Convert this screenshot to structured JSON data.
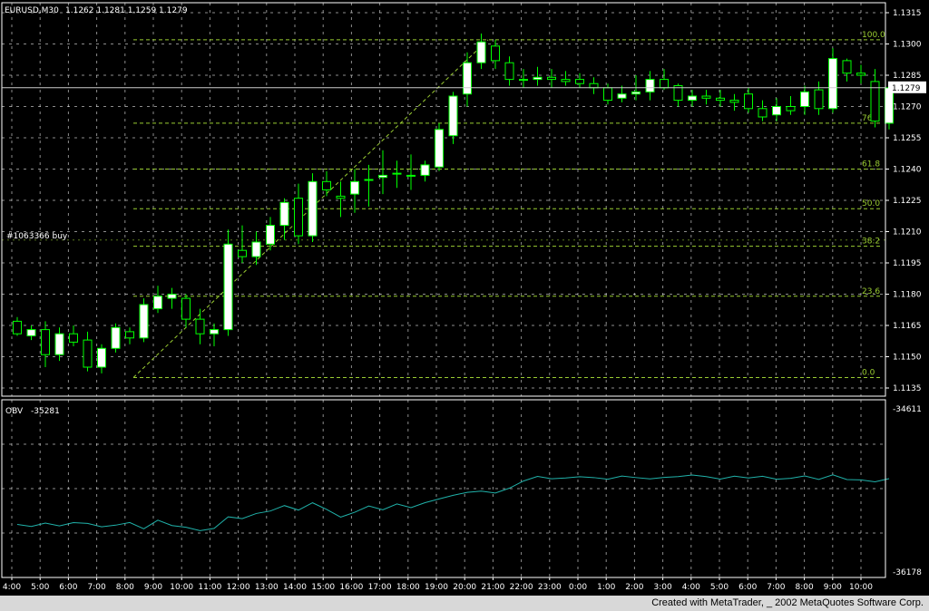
{
  "header": {
    "symbol": "EURUSD,M30",
    "ohlc": "1.1262 1.1281 1.1259 1.1279"
  },
  "order_label": "#1063366 buy",
  "obv_label": "OBV",
  "obv_value": "-35281",
  "footer": {
    "text": "Created with MetaTrader, _ 2002 MetaQuotes Software Corp."
  },
  "colors": {
    "background": "#000000",
    "grid": "#ffffff",
    "fib": "#9acd32",
    "bull_fill": "#ffffff",
    "bear_fill": "#000000",
    "candle_outline": "#00ff00",
    "obv_line": "#20b2aa"
  },
  "chart_data": [
    {
      "type": "candlestick",
      "price_ticks": [
        "1.1315",
        "1.1300",
        "1.1285",
        "1.1270",
        "1.1255",
        "1.1240",
        "1.1225",
        "1.1210",
        "1.1195",
        "1.1180",
        "1.1165",
        "1.1150",
        "1.1135"
      ],
      "current_price": "1.1279",
      "ylim": [
        1.1135,
        1.1318
      ],
      "time_labels": [
        "4:00",
        "5:00",
        "6:00",
        "7:00",
        "8:00",
        "9:00",
        "10:00",
        "11:00",
        "12:00",
        "13:00",
        "14:00",
        "15:00",
        "16:00",
        "17:00",
        "18:00",
        "19:00",
        "20:00",
        "21:00",
        "22:00",
        "23:00",
        "0:00",
        "1:00",
        "2:00",
        "3:00",
        "4:00",
        "5:00",
        "6:00",
        "7:00",
        "8:00",
        "9:00",
        "10:00"
      ],
      "fibonacci": [
        {
          "label": "100.0",
          "price": 1.1302
        },
        {
          "label": "76.4",
          "price": 1.1262
        },
        {
          "label": "61.8",
          "price": 1.124
        },
        {
          "label": "50.0",
          "price": 1.1221
        },
        {
          "label": "38.2",
          "price": 1.1203
        },
        {
          "label": "23.6",
          "price": 1.1179
        },
        {
          "label": "0.0",
          "price": 1.114
        }
      ],
      "order_price": 1.1206,
      "candles": [
        {
          "o": 1.1167,
          "h": 1.1169,
          "l": 1.116,
          "c": 1.1161
        },
        {
          "o": 1.116,
          "h": 1.1165,
          "l": 1.1158,
          "c": 1.1163
        },
        {
          "o": 1.1163,
          "h": 1.1167,
          "l": 1.1145,
          "c": 1.1151
        },
        {
          "o": 1.1151,
          "h": 1.1164,
          "l": 1.1148,
          "c": 1.1161
        },
        {
          "o": 1.1161,
          "h": 1.1165,
          "l": 1.1155,
          "c": 1.1157
        },
        {
          "o": 1.1158,
          "h": 1.1162,
          "l": 1.1143,
          "c": 1.1145
        },
        {
          "o": 1.1145,
          "h": 1.1156,
          "l": 1.1142,
          "c": 1.1154
        },
        {
          "o": 1.1154,
          "h": 1.1166,
          "l": 1.1152,
          "c": 1.1164
        },
        {
          "o": 1.1162,
          "h": 1.1164,
          "l": 1.1156,
          "c": 1.1159
        },
        {
          "o": 1.1159,
          "h": 1.1178,
          "l": 1.1157,
          "c": 1.1175
        },
        {
          "o": 1.1173,
          "h": 1.1184,
          "l": 1.1171,
          "c": 1.1179
        },
        {
          "o": 1.1178,
          "h": 1.1183,
          "l": 1.1173,
          "c": 1.118
        },
        {
          "o": 1.1178,
          "h": 1.118,
          "l": 1.1164,
          "c": 1.1168
        },
        {
          "o": 1.1168,
          "h": 1.1173,
          "l": 1.1156,
          "c": 1.1161
        },
        {
          "o": 1.1161,
          "h": 1.1166,
          "l": 1.1155,
          "c": 1.1163
        },
        {
          "o": 1.1163,
          "h": 1.1211,
          "l": 1.116,
          "c": 1.1204
        },
        {
          "o": 1.1201,
          "h": 1.1213,
          "l": 1.1195,
          "c": 1.1198
        },
        {
          "o": 1.1198,
          "h": 1.121,
          "l": 1.1194,
          "c": 1.1205
        },
        {
          "o": 1.1204,
          "h": 1.1217,
          "l": 1.1201,
          "c": 1.1213
        },
        {
          "o": 1.1213,
          "h": 1.1226,
          "l": 1.1206,
          "c": 1.1224
        },
        {
          "o": 1.1226,
          "h": 1.1233,
          "l": 1.1204,
          "c": 1.1208
        },
        {
          "o": 1.1208,
          "h": 1.1238,
          "l": 1.1205,
          "c": 1.1234
        },
        {
          "o": 1.1234,
          "h": 1.1239,
          "l": 1.1227,
          "c": 1.123
        },
        {
          "o": 1.1227,
          "h": 1.1234,
          "l": 1.1217,
          "c": 1.1226
        },
        {
          "o": 1.1228,
          "h": 1.124,
          "l": 1.1219,
          "c": 1.1234
        },
        {
          "o": 1.1235,
          "h": 1.1242,
          "l": 1.1222,
          "c": 1.1235
        },
        {
          "o": 1.1236,
          "h": 1.1249,
          "l": 1.1228,
          "c": 1.1237
        },
        {
          "o": 1.1238,
          "h": 1.1244,
          "l": 1.1231,
          "c": 1.1238
        },
        {
          "o": 1.1237,
          "h": 1.1247,
          "l": 1.123,
          "c": 1.1237
        },
        {
          "o": 1.1237,
          "h": 1.1244,
          "l": 1.1234,
          "c": 1.1242
        },
        {
          "o": 1.1241,
          "h": 1.1262,
          "l": 1.1239,
          "c": 1.1259
        },
        {
          "o": 1.1256,
          "h": 1.1277,
          "l": 1.1252,
          "c": 1.1275
        },
        {
          "o": 1.1276,
          "h": 1.1296,
          "l": 1.127,
          "c": 1.1291
        },
        {
          "o": 1.1291,
          "h": 1.1305,
          "l": 1.1288,
          "c": 1.1301
        },
        {
          "o": 1.1299,
          "h": 1.1302,
          "l": 1.1288,
          "c": 1.1292
        },
        {
          "o": 1.1291,
          "h": 1.1294,
          "l": 1.128,
          "c": 1.1283
        },
        {
          "o": 1.1283,
          "h": 1.1288,
          "l": 1.1279,
          "c": 1.1283
        },
        {
          "o": 1.1283,
          "h": 1.1289,
          "l": 1.128,
          "c": 1.1284
        },
        {
          "o": 1.1284,
          "h": 1.1288,
          "l": 1.1279,
          "c": 1.1283
        },
        {
          "o": 1.1283,
          "h": 1.1287,
          "l": 1.128,
          "c": 1.1282
        },
        {
          "o": 1.1283,
          "h": 1.1286,
          "l": 1.1279,
          "c": 1.1281
        },
        {
          "o": 1.1281,
          "h": 1.1284,
          "l": 1.1276,
          "c": 1.1279
        },
        {
          "o": 1.1279,
          "h": 1.1281,
          "l": 1.1271,
          "c": 1.1273
        },
        {
          "o": 1.1274,
          "h": 1.128,
          "l": 1.1272,
          "c": 1.1276
        },
        {
          "o": 1.1276,
          "h": 1.1285,
          "l": 1.1273,
          "c": 1.1277
        },
        {
          "o": 1.1277,
          "h": 1.1287,
          "l": 1.1273,
          "c": 1.1283
        },
        {
          "o": 1.1283,
          "h": 1.1288,
          "l": 1.1278,
          "c": 1.1279
        },
        {
          "o": 1.128,
          "h": 1.1281,
          "l": 1.127,
          "c": 1.1273
        },
        {
          "o": 1.1273,
          "h": 1.1278,
          "l": 1.127,
          "c": 1.1275
        },
        {
          "o": 1.1275,
          "h": 1.1278,
          "l": 1.1271,
          "c": 1.1274
        },
        {
          "o": 1.1274,
          "h": 1.1278,
          "l": 1.127,
          "c": 1.1273
        },
        {
          "o": 1.1273,
          "h": 1.1276,
          "l": 1.1268,
          "c": 1.1272
        },
        {
          "o": 1.1276,
          "h": 1.1279,
          "l": 1.1267,
          "c": 1.1269
        },
        {
          "o": 1.1269,
          "h": 1.1273,
          "l": 1.1263,
          "c": 1.1265
        },
        {
          "o": 1.1266,
          "h": 1.1274,
          "l": 1.1263,
          "c": 1.127
        },
        {
          "o": 1.127,
          "h": 1.1275,
          "l": 1.1266,
          "c": 1.1268
        },
        {
          "o": 1.127,
          "h": 1.128,
          "l": 1.1266,
          "c": 1.1277
        },
        {
          "o": 1.1278,
          "h": 1.1282,
          "l": 1.1266,
          "c": 1.1269
        },
        {
          "o": 1.1269,
          "h": 1.1298,
          "l": 1.1267,
          "c": 1.1293
        },
        {
          "o": 1.1292,
          "h": 1.1293,
          "l": 1.1282,
          "c": 1.1286
        },
        {
          "o": 1.1286,
          "h": 1.129,
          "l": 1.1281,
          "c": 1.1285
        },
        {
          "o": 1.1282,
          "h": 1.1288,
          "l": 1.126,
          "c": 1.1263
        },
        {
          "o": 1.1262,
          "h": 1.1281,
          "l": 1.1259,
          "c": 1.1279
        }
      ]
    },
    {
      "type": "line",
      "name": "OBV",
      "ylim": [
        -36178,
        -34611
      ],
      "tick_labels": [
        "-34611",
        "-36178"
      ],
      "values": [
        -35721,
        -35740,
        -35708,
        -35735,
        -35704,
        -35711,
        -35744,
        -35728,
        -35703,
        -35763,
        -35680,
        -35732,
        -35748,
        -35781,
        -35759,
        -35648,
        -35665,
        -35616,
        -35592,
        -35540,
        -35583,
        -35513,
        -35577,
        -35651,
        -35604,
        -35544,
        -35580,
        -35524,
        -35560,
        -35512,
        -35476,
        -35441,
        -35413,
        -35401,
        -35419,
        -35373,
        -35304,
        -35260,
        -35282,
        -35275,
        -35263,
        -35271,
        -35287,
        -35256,
        -35271,
        -35284,
        -35269,
        -35262,
        -35247,
        -35262,
        -35286,
        -35257,
        -35275,
        -35259,
        -35287,
        -35278,
        -35255,
        -35289,
        -35245,
        -35290,
        -35293,
        -35312,
        -35281
      ]
    }
  ]
}
